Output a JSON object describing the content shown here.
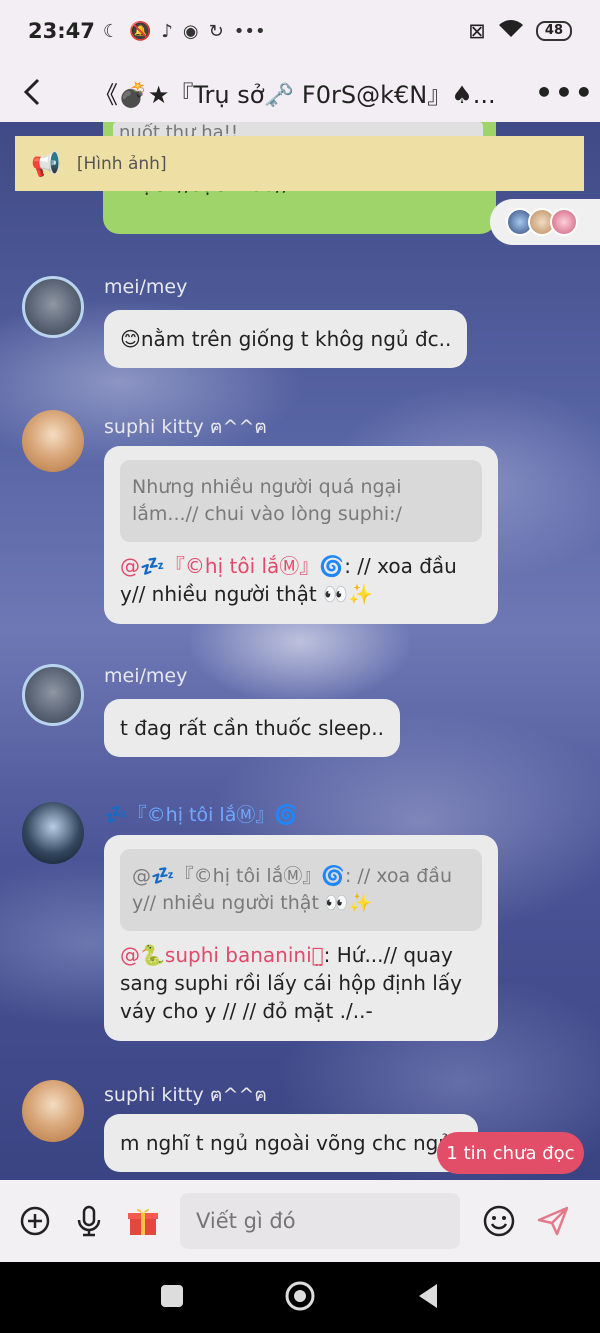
{
  "status_bar": {
    "time": "23:47",
    "icons": [
      "moon-icon",
      "mute-icon",
      "tiktok-icon",
      "app-icon",
      "sync-icon"
    ],
    "more": "•••",
    "battery": "48"
  },
  "header": {
    "back": "<",
    "title": "《💣★『Trụ sở🗝️ F0rS@k€N』♠...",
    "more": "•••"
  },
  "pinned": {
    "quote_text": "nuốt thư ha!!",
    "message_text": "khặc- //sặc máu//",
    "announcement": "[Hình ảnh]"
  },
  "messages": [
    {
      "name": "mei/mey",
      "text": "😊nằm trên giống t khôg ngủ đc.."
    },
    {
      "name": "suphi kitty ฅ^^ฅ",
      "quote": "Nhưng nhiều người quá ngại lắm...// chui vào lòng suphi:/",
      "mention": "@💤『©hị tôi lắⓂ』🌀",
      "text": ": // xoa đầu y// nhiều người thật 👀✨"
    },
    {
      "name": "mei/mey",
      "text": "t đag rất cần thuốc sleep.."
    },
    {
      "name": "💤『©hị tôi lắⓂ』🌀",
      "quote": "@💤『©hị tôi lắⓂ』🌀: // xoa đầu y// nhiều người thật 👀✨",
      "mention": "@🐍suphi bananiniꪔ̤",
      "text": ": Hứ...// quay sang suphi rồi lấy cái hộp định lấy váy cho y // // đỏ mặt ./..-"
    },
    {
      "name": "suphi kitty ฅ^^ฅ",
      "text": "m nghĩ t ngủ ngoài võng chc ngủ"
    }
  ],
  "unread_badge": "1 tin chưa đọc",
  "input": {
    "placeholder": "Viết gì đó"
  },
  "colors": {
    "accent": "#e24d68",
    "bubble": "#ebebeb",
    "green_bubble": "#9fd46b",
    "announce_bg": "#eee0a4",
    "mention": "#e14a6b"
  }
}
